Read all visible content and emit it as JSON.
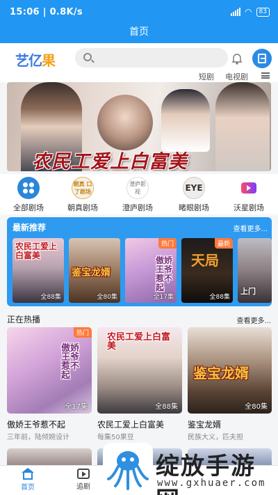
{
  "status_bar": {
    "text": "15:06 | 0.8K/s",
    "battery": "83"
  },
  "header": {
    "title": "首页"
  },
  "logo": {
    "part1": "艺亿",
    "part2": "果"
  },
  "categories": {
    "short": "短剧",
    "tv": "电视剧"
  },
  "banner": {
    "title": "农民工爱上白富美"
  },
  "channels": [
    {
      "label": "全部剧场",
      "icon": "grid-icon"
    },
    {
      "label": "朝真剧场",
      "icon_text": "朝真 口了剧场",
      "icon": "zhaozhen-icon"
    },
    {
      "label": "澄庐剧场",
      "icon_text": "澄庐影视",
      "icon": "chenglu-icon"
    },
    {
      "label": "睹眼剧场",
      "icon_text": "EYE",
      "icon": "dyan-icon"
    },
    {
      "label": "沃星剧场",
      "icon": "tv-icon"
    }
  ],
  "recommend": {
    "title": "最新推荐",
    "more": "查看更多...",
    "cards": [
      {
        "poster": "农民工爱上白富美",
        "ep": "全88集",
        "tag": ""
      },
      {
        "poster": "鉴宝龙婿",
        "ep": "全80集",
        "tag": ""
      },
      {
        "poster": "傲娇王爷惹不起",
        "ep": "全17集",
        "tag": "热门"
      },
      {
        "poster": "天局",
        "ep": "全88集",
        "tag": "最新"
      },
      {
        "poster": "上门",
        "ep": "",
        "tag": ""
      }
    ]
  },
  "hot": {
    "title": "正在热播",
    "more": "查看更多...",
    "items": [
      {
        "name": "傲娇王爷惹不起",
        "desc": "三年前，陆倾婉设计",
        "ep": "全17集",
        "tag": "热门",
        "poster": "傲娇王爷惹不起"
      },
      {
        "name": "农民工爱上白富美",
        "desc": "每集50果豆",
        "ep": "全88集",
        "tag": "",
        "poster": "农民工爱上白富美"
      },
      {
        "name": "鉴宝龙婿",
        "desc": "民族大义，匹夫担",
        "ep": "全80集",
        "tag": "",
        "poster": "鉴宝龙婿"
      }
    ]
  },
  "tabs": [
    {
      "label": "首页"
    },
    {
      "label": "追剧"
    }
  ],
  "watermark": {
    "text": "绽放手游网",
    "url": "www.gxhuaer.com"
  },
  "colors": {
    "primary": "#2196f3",
    "accent": "#ff7a3b",
    "title_red": "#a3141a"
  }
}
